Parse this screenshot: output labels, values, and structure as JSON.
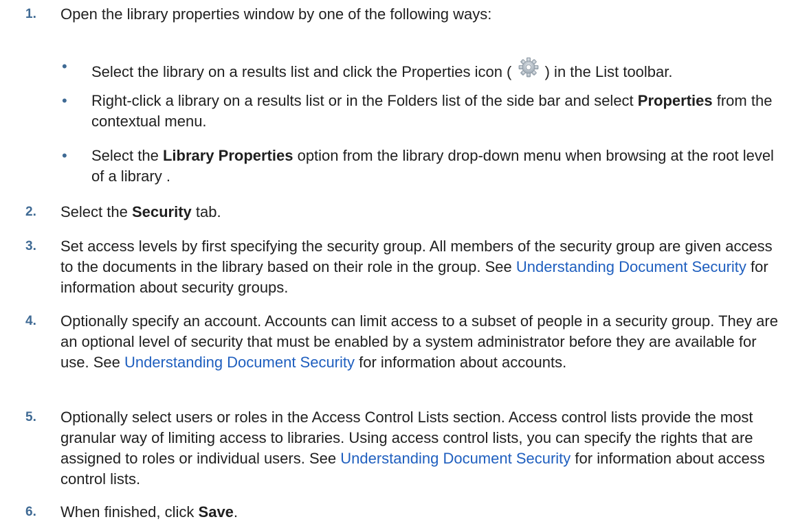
{
  "steps": [
    {
      "num": "1.",
      "text": "Open the library properties window by one of the following ways:"
    },
    {
      "num": "2.",
      "pre": "Select the ",
      "bold": "Security",
      "post": " tab."
    },
    {
      "num": "3.",
      "pre": "Set access levels by first specifying the security group. All members of the security group are given access to the documents in the library based on their role in the group. See ",
      "link": "Understanding Document Security",
      "post": " for information about security groups."
    },
    {
      "num": "4.",
      "pre": "Optionally specify an account. Accounts can limit access to a subset of people in a security group. They are an optional level of security that must be enabled by a system administrator before they are available for use. See ",
      "link": "Understanding Document Security",
      "post": " for information about accounts."
    },
    {
      "num": "5.",
      "pre": "Optionally select users or roles in the Access Control Lists section. Access control lists provide the most granular way of limiting access to libraries. Using access control lists, you can specify the rights that are assigned to roles or individual users. See ",
      "link": "Understanding Document Security",
      "post": " for information about access control lists."
    },
    {
      "num": "6.",
      "pre": "When finished, click ",
      "bold": "Save",
      "post": "."
    }
  ],
  "bullets": [
    {
      "dot": "•",
      "pre": "Select the library on a results list and click the Properties icon ( ",
      "icon": "gear-icon",
      "post": " ) in the List toolbar."
    },
    {
      "dot": "•",
      "pre": "Right-click a library on a results list or in the Folders list of the side bar and select ",
      "bold": "Properties",
      "post": " from the contextual menu."
    },
    {
      "dot": "•",
      "pre": "Select the ",
      "bold": "Library Properties",
      "post": " option from the library drop-down menu when browsing at the root level of a library ."
    }
  ],
  "colors": {
    "number": "#3f6a94",
    "link": "#1f5fbf",
    "text": "#1f1f1f"
  }
}
